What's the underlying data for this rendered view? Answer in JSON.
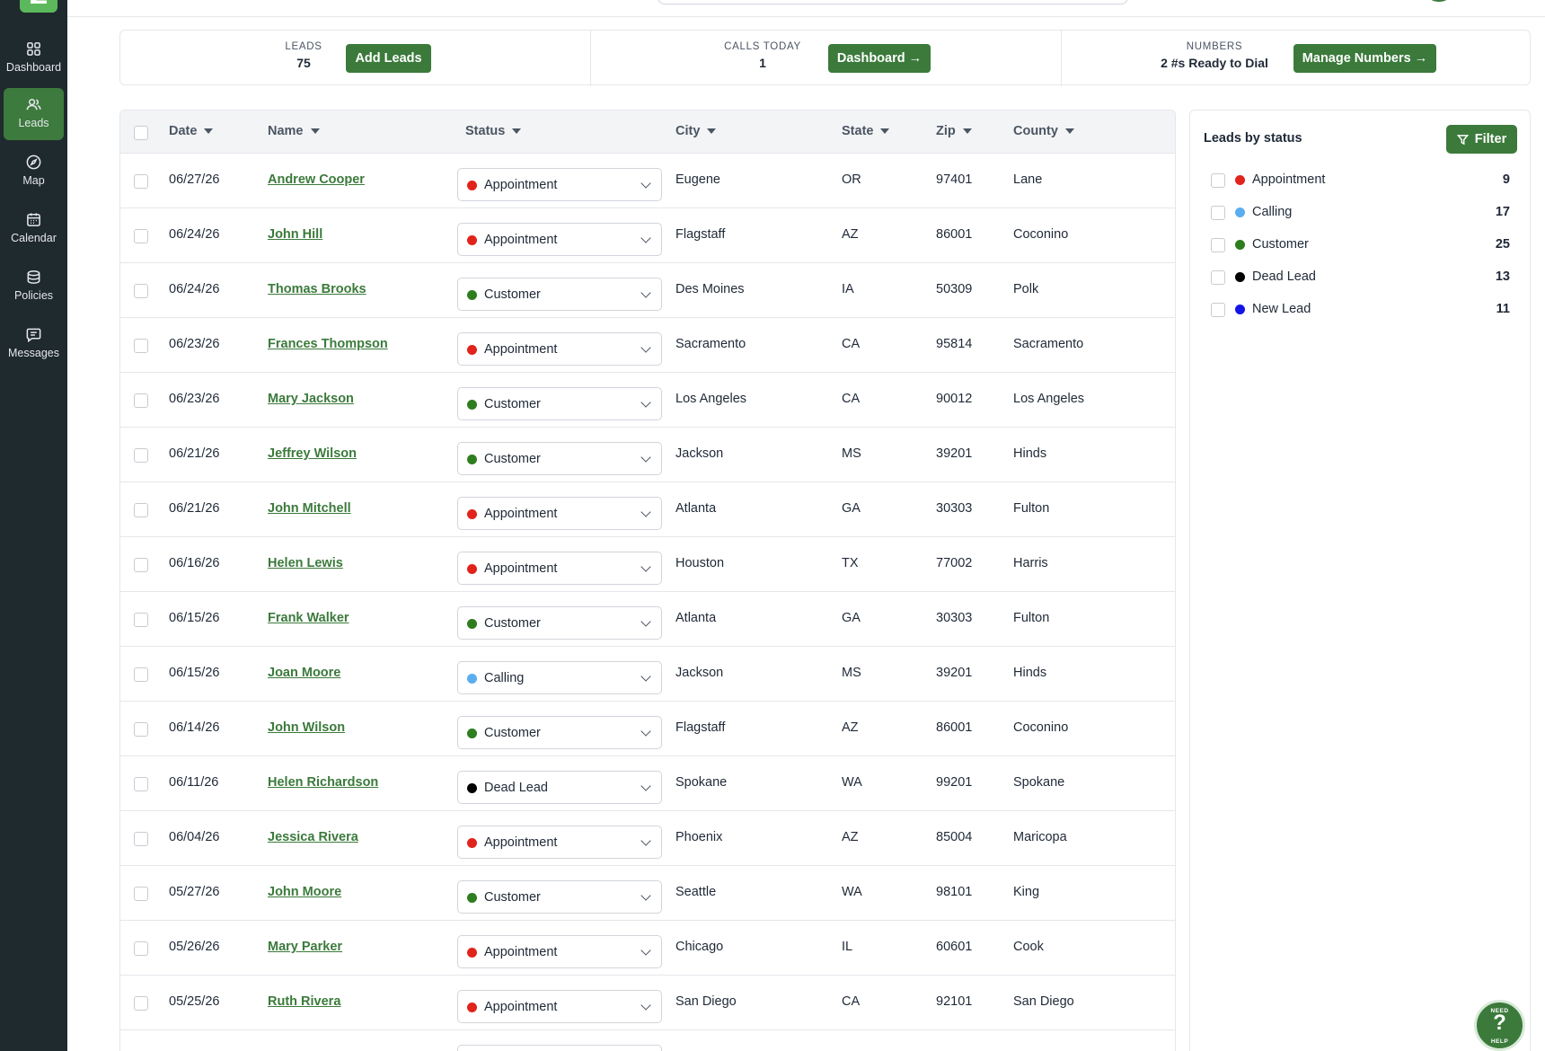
{
  "sidebar": {
    "items": [
      {
        "label": "Dashboard",
        "icon": "grid-icon",
        "active": false
      },
      {
        "label": "Leads",
        "icon": "users-icon",
        "active": true
      },
      {
        "label": "Map",
        "icon": "compass-icon",
        "active": false
      },
      {
        "label": "Calendar",
        "icon": "calendar-icon",
        "active": false
      },
      {
        "label": "Policies",
        "icon": "database-icon",
        "active": false
      },
      {
        "label": "Messages",
        "icon": "message-icon",
        "active": false
      }
    ]
  },
  "stats": {
    "leads": {
      "label": "LEADS",
      "value": "75",
      "button": "Add Leads"
    },
    "calls": {
      "label": "CALLS TODAY",
      "value": "1",
      "button": "Dashboard →"
    },
    "numbers": {
      "label": "NUMBERS",
      "value": "2 #s Ready to Dial",
      "button": "Manage Numbers →"
    }
  },
  "table": {
    "columns": [
      "Date",
      "Name",
      "Status",
      "City",
      "State",
      "Zip",
      "County"
    ],
    "rows": [
      {
        "date": "06/27/26",
        "name": "Andrew Cooper",
        "status": "Appointment",
        "city": "Eugene",
        "state": "OR",
        "zip": "97401",
        "county": "Lane"
      },
      {
        "date": "06/24/26",
        "name": "John Hill",
        "status": "Appointment",
        "city": "Flagstaff",
        "state": "AZ",
        "zip": "86001",
        "county": "Coconino"
      },
      {
        "date": "06/24/26",
        "name": "Thomas Brooks",
        "status": "Customer",
        "city": "Des Moines",
        "state": "IA",
        "zip": "50309",
        "county": "Polk"
      },
      {
        "date": "06/23/26",
        "name": "Frances Thompson",
        "status": "Appointment",
        "city": "Sacramento",
        "state": "CA",
        "zip": "95814",
        "county": "Sacramento"
      },
      {
        "date": "06/23/26",
        "name": "Mary Jackson",
        "status": "Customer",
        "city": "Los Angeles",
        "state": "CA",
        "zip": "90012",
        "county": "Los Angeles"
      },
      {
        "date": "06/21/26",
        "name": "Jeffrey Wilson",
        "status": "Customer",
        "city": "Jackson",
        "state": "MS",
        "zip": "39201",
        "county": "Hinds"
      },
      {
        "date": "06/21/26",
        "name": "John Mitchell",
        "status": "Appointment",
        "city": "Atlanta",
        "state": "GA",
        "zip": "30303",
        "county": "Fulton"
      },
      {
        "date": "06/16/26",
        "name": "Helen Lewis",
        "status": "Appointment",
        "city": "Houston",
        "state": "TX",
        "zip": "77002",
        "county": "Harris"
      },
      {
        "date": "06/15/26",
        "name": "Frank Walker",
        "status": "Customer",
        "city": "Atlanta",
        "state": "GA",
        "zip": "30303",
        "county": "Fulton"
      },
      {
        "date": "06/15/26",
        "name": "Joan Moore",
        "status": "Calling",
        "city": "Jackson",
        "state": "MS",
        "zip": "39201",
        "county": "Hinds"
      },
      {
        "date": "06/14/26",
        "name": "John Wilson",
        "status": "Customer",
        "city": "Flagstaff",
        "state": "AZ",
        "zip": "86001",
        "county": "Coconino"
      },
      {
        "date": "06/11/26",
        "name": "Helen Richardson",
        "status": "Dead Lead",
        "city": "Spokane",
        "state": "WA",
        "zip": "99201",
        "county": "Spokane"
      },
      {
        "date": "06/04/26",
        "name": "Jessica Rivera",
        "status": "Appointment",
        "city": "Phoenix",
        "state": "AZ",
        "zip": "85004",
        "county": "Maricopa"
      },
      {
        "date": "05/27/26",
        "name": "John Moore",
        "status": "Customer",
        "city": "Seattle",
        "state": "WA",
        "zip": "98101",
        "county": "King"
      },
      {
        "date": "05/26/26",
        "name": "Mary Parker",
        "status": "Appointment",
        "city": "Chicago",
        "state": "IL",
        "zip": "60601",
        "county": "Cook"
      },
      {
        "date": "05/25/26",
        "name": "Ruth Rivera",
        "status": "Appointment",
        "city": "San Diego",
        "state": "CA",
        "zip": "92101",
        "county": "San Diego"
      }
    ]
  },
  "status_colors": {
    "Appointment": "#e0241b",
    "Calling": "#5aaef0",
    "Customer": "#2e7d1e",
    "Dead Lead": "#000000",
    "New Lead": "#1414e6"
  },
  "panel": {
    "title": "Leads by status",
    "filter_label": "Filter",
    "statuses": [
      {
        "label": "Appointment",
        "count": "9"
      },
      {
        "label": "Calling",
        "count": "17"
      },
      {
        "label": "Customer",
        "count": "25"
      },
      {
        "label": "Dead Lead",
        "count": "13"
      },
      {
        "label": "New Lead",
        "count": "11"
      }
    ]
  },
  "help": {
    "top": "NEED",
    "mark": "?",
    "bottom": "HELP"
  }
}
